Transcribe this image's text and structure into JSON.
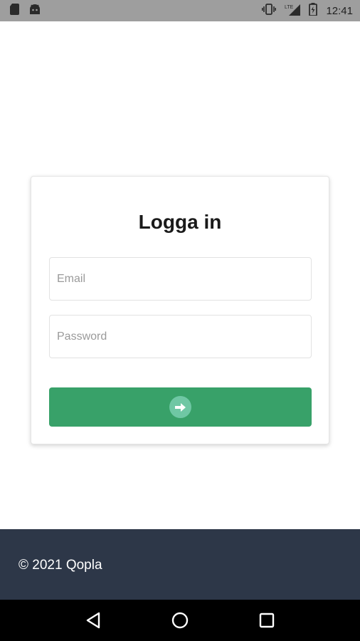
{
  "status_bar": {
    "time": "12:41",
    "left_icons": [
      "sd-card-icon",
      "android-icon"
    ],
    "right_icons": [
      "vibrate-icon",
      "signal-lte-icon",
      "battery-icon"
    ]
  },
  "login": {
    "title": "Logga in",
    "email_placeholder": "Email",
    "password_placeholder": "Password",
    "submit_icon": "arrow-right-icon"
  },
  "footer": {
    "copyright": "© 2021 Qopla"
  },
  "nav_bar": {
    "buttons": [
      "back-icon",
      "home-icon",
      "recents-icon"
    ]
  },
  "colors": {
    "status_bar": "#9e9e9e",
    "button": "#38a169",
    "button_icon_circle": "#6fc7a4",
    "footer": "#2d3748",
    "nav_bar": "#000000"
  }
}
